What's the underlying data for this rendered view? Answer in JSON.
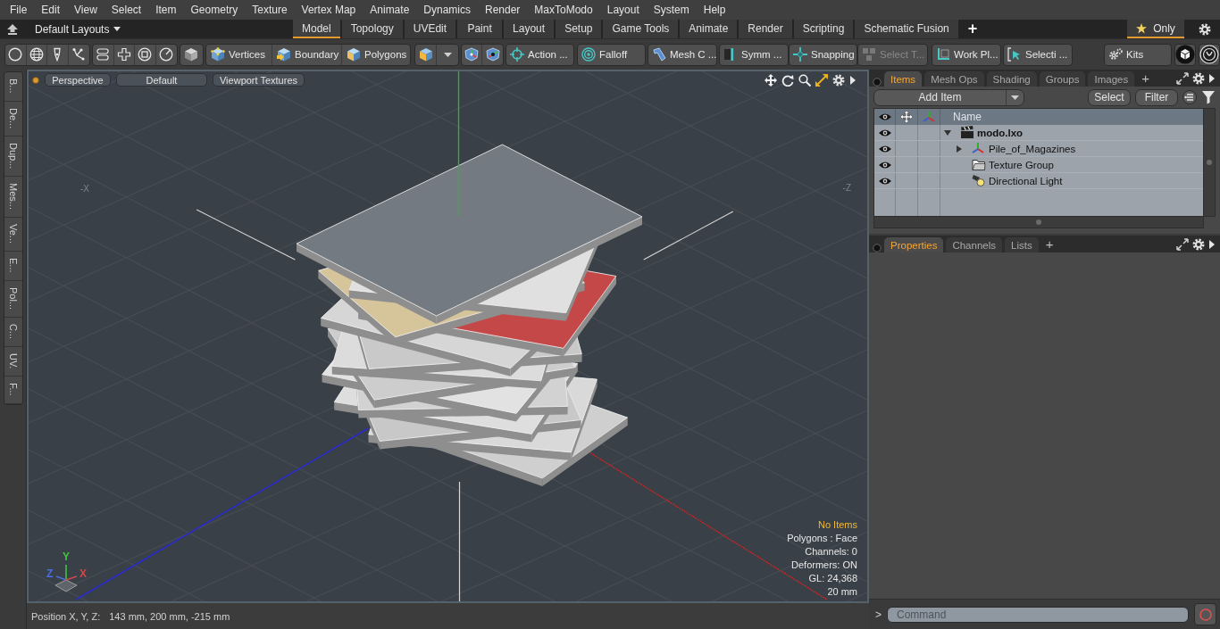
{
  "menu_bar": [
    "File",
    "Edit",
    "View",
    "Select",
    "Item",
    "Geometry",
    "Texture",
    "Vertex Map",
    "Animate",
    "Dynamics",
    "Render",
    "MaxToModo",
    "Layout",
    "System",
    "Help"
  ],
  "layout_bar": {
    "layouts_menu": "Default Layouts",
    "tabs": [
      {
        "label": "Model",
        "selected": true
      },
      {
        "label": "Topology",
        "selected": false
      },
      {
        "label": "UVEdit",
        "selected": false
      },
      {
        "label": "Paint",
        "selected": false
      },
      {
        "label": "Layout",
        "selected": false
      },
      {
        "label": "Setup",
        "selected": false
      },
      {
        "label": "Game Tools",
        "selected": false
      },
      {
        "label": "Animate",
        "selected": false
      },
      {
        "label": "Render",
        "selected": false
      },
      {
        "label": "Scripting",
        "selected": false
      },
      {
        "label": "Schematic Fusion",
        "selected": false
      }
    ],
    "add_tab": "+",
    "favorite": {
      "label": "Only",
      "selected": true
    }
  },
  "toolbar": {
    "selection_modes": [
      "Vertices",
      "Boundary",
      "Polygons"
    ],
    "tools": [
      {
        "label": "Action ...",
        "disabled": false
      },
      {
        "label": "Falloff",
        "disabled": false
      },
      {
        "label": "Mesh C ...",
        "disabled": false
      },
      {
        "label": "Symm ...",
        "disabled": false
      },
      {
        "label": "Snapping",
        "disabled": false
      },
      {
        "label": "Select T...",
        "disabled": true
      },
      {
        "label": "Work Pl...",
        "disabled": false
      },
      {
        "label": "Selecti ...",
        "disabled": false
      }
    ],
    "kits": "Kits"
  },
  "side_tabs": [
    "B...",
    "De...",
    "Dup...",
    "Mes...",
    "Ve...",
    "E...",
    "Pol...",
    "C...",
    "UV.",
    "F..."
  ],
  "viewport": {
    "view_buttons": [
      "Perspective",
      "Default",
      "Viewport Textures"
    ],
    "scene_labels": [
      "-X",
      "-Z"
    ],
    "info": [
      {
        "text": "No Items",
        "kind": "highlight"
      },
      {
        "text": "Polygons : Face",
        "kind": "plain"
      },
      {
        "text": "Channels: 0",
        "kind": "plain"
      },
      {
        "text": "Deformers: ON",
        "kind": "plain"
      },
      {
        "text": "GL: 24,368",
        "kind": "plain"
      },
      {
        "text": "20 mm",
        "kind": "plain"
      }
    ],
    "gizmo_axes": [
      {
        "label": "Y",
        "color": "#3ec43e"
      },
      {
        "label": "Z",
        "color": "#4a6ee0"
      },
      {
        "label": "X",
        "color": "#d04848"
      }
    ]
  },
  "status_bar": {
    "label": "Position X, Y, Z:",
    "value": "143 mm, 200 mm, -215 mm"
  },
  "items_panel": {
    "tabs": [
      {
        "label": "Items",
        "selected": true
      },
      {
        "label": "Mesh Ops",
        "selected": false
      },
      {
        "label": "Shading",
        "selected": false
      },
      {
        "label": "Groups",
        "selected": false
      },
      {
        "label": "Images",
        "selected": false
      }
    ],
    "add_tab": "+",
    "add_item": "Add Item",
    "buttons": [
      "Select",
      "Filter"
    ],
    "name_column": "Name",
    "tree": [
      {
        "name": "modo.lxo",
        "kind": "scene",
        "visible": true,
        "expanded": true,
        "children": [
          {
            "name": "Pile_of_Magazines",
            "kind": "mesh",
            "visible": true,
            "expanded": false
          },
          {
            "name": "Texture Group",
            "kind": "group",
            "visible": true
          },
          {
            "name": "Directional Light",
            "kind": "light",
            "visible": true
          }
        ]
      }
    ]
  },
  "properties_panel": {
    "tabs": [
      {
        "label": "Properties",
        "selected": true
      },
      {
        "label": "Channels",
        "selected": false
      },
      {
        "label": "Lists",
        "selected": false
      }
    ],
    "add_tab": "+"
  },
  "command_bar": {
    "prompt": ">",
    "placeholder": "Command"
  }
}
